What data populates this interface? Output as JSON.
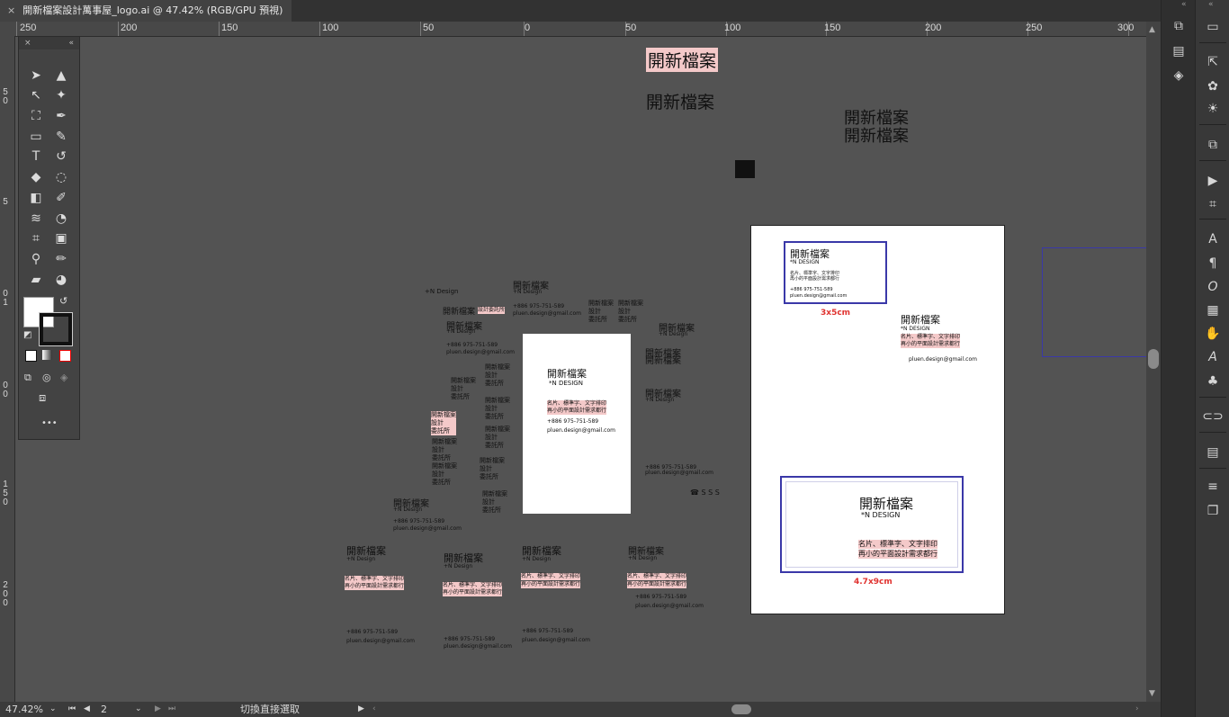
{
  "tab": {
    "title": "開新檔案設計萬事屋_logo.ai @ 47.42% (RGB/GPU 預視)",
    "close": "×"
  },
  "ruler_top": [
    "250",
    "200",
    "150",
    "100",
    "50",
    "0",
    "50",
    "100",
    "150",
    "200",
    "250",
    "300"
  ],
  "ruler_left": [
    "5",
    "0",
    "5",
    "0",
    "1",
    "0",
    "0",
    "1",
    "5",
    "0",
    "2",
    "0",
    "0"
  ],
  "toolbar": {
    "collapse": "×",
    "expand": "«",
    "more": "•••"
  },
  "status": {
    "zoom": "47.42%",
    "page": "2",
    "tool": "切換直接選取"
  },
  "artwork": {
    "title_hl": "開新檔案",
    "title_plain": "開新檔案",
    "title_line1": "開新檔案",
    "title_line2": "開新檔案",
    "brand": "開新檔案",
    "sub": "+N Design",
    "sub_caps": "*N DESIGN",
    "studio": "設計委託所",
    "studio_a": "開新檔案",
    "studio_b": "設計",
    "studio_c": "委託所",
    "tagline1": "名片、標準字、文字排印",
    "tagline2": "再小的平面設計需求都行",
    "phone": "+886 975-751-589",
    "email": "pluen.design@gmail.com",
    "phone_icon": "☎",
    "mail_icon": "■",
    "sss": "☎ S S S",
    "label_small": "3x5cm",
    "label_large": "4.7x9cm",
    "side_vert": "設計委託所"
  },
  "colors": {
    "accent_red": "#e0322f",
    "frame_blue": "#3a38a8",
    "highlight": "#f4c9c9"
  }
}
